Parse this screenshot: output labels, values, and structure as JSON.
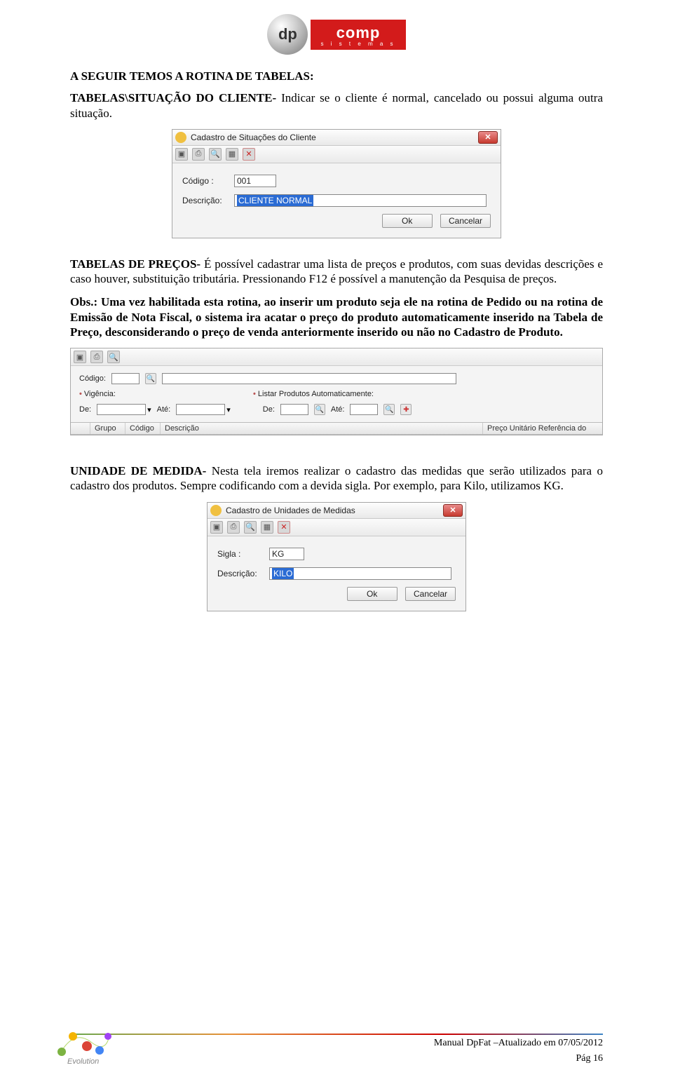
{
  "logo": {
    "dp": "dp",
    "comp": "comp",
    "sub": "s i s t e m a s"
  },
  "heading1": "A SEGUIR TEMOS A ROTINA DE TABELAS:",
  "para1_lead": "TABELAS\\SITUAÇÃO DO CLIENTE-",
  "para1_rest": " Indicar se o cliente é normal, cancelado ou possui alguma outra situação.",
  "win1": {
    "title": "Cadastro de Situações do Cliente",
    "codigo_label": "Código :",
    "codigo_value": "001",
    "desc_label": "Descrição:",
    "desc_value": "CLIENTE NORMAL",
    "ok": "Ok",
    "cancel": "Cancelar"
  },
  "para2_lead": "TABELAS DE PREÇOS-",
  "para2_rest": " É possível cadastrar uma lista de preços e produtos, com suas devidas descrições e caso houver, substituição tributária. Pressionando F12 é possível a manutenção da Pesquisa de preços.",
  "para3": "Obs.: Uma vez habilitada esta rotina, ao inserir um produto seja ele na rotina de Pedido ou na rotina de Emissão de Nota Fiscal, o sistema ira acatar o preço do produto automaticamente inserido na Tabela de Preço, desconsiderando o preço de venda anteriormente inserido ou não no Cadastro de Produto.",
  "grid": {
    "codigo_label": "Código:",
    "vig_label": "Vigência:",
    "listar_label": "Listar Produtos Automaticamente:",
    "de": "De:",
    "ate": "Até:",
    "h_grupo": "Grupo",
    "h_codigo": "Código",
    "h_desc": "Descrição",
    "h_preco": "Preço Unitário Referência do"
  },
  "para4_lead": "UNIDADE DE MEDIDA-",
  "para4_rest": " Nesta tela iremos realizar o cadastro das medidas que serão utilizados para o cadastro dos produtos. Sempre codificando com a devida sigla. Por exemplo, para Kilo, utilizamos KG.",
  "win2": {
    "title": "Cadastro de Unidades de Medidas",
    "sigla_label": "Sigla :",
    "sigla_value": "KG",
    "desc_label": "Descrição:",
    "desc_value": "KILO",
    "ok": "Ok",
    "cancel": "Cancelar"
  },
  "footer": {
    "line": "Manual DpFat –Atualizado em 07/05/2012",
    "page": "Pág 16"
  }
}
